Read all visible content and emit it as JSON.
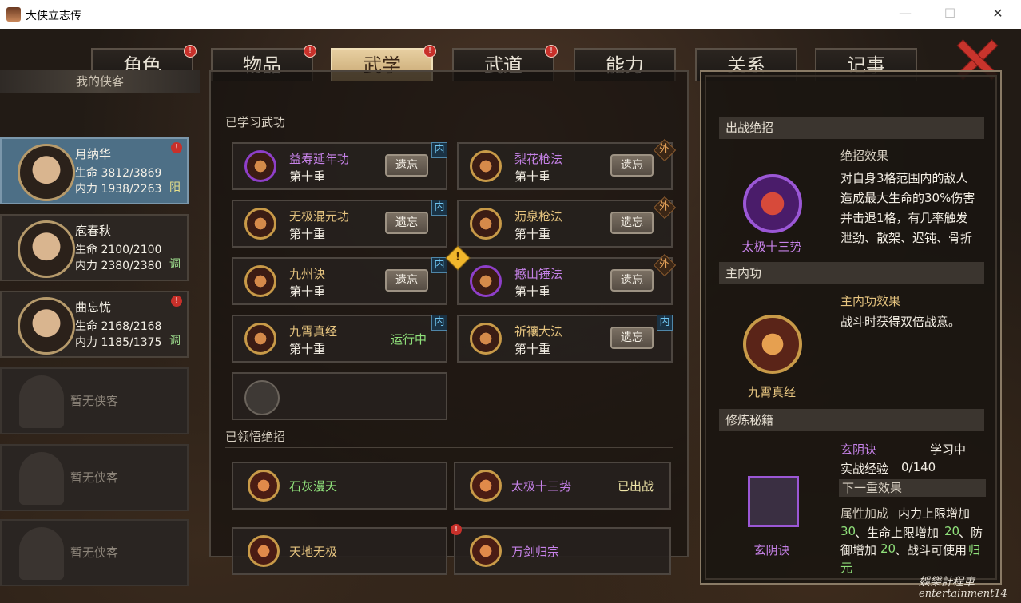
{
  "window": {
    "title": "大侠立志传",
    "min_label": "—",
    "max_label": "☐",
    "close_label": "✕"
  },
  "tabs": [
    {
      "label": "角色",
      "alert": "!"
    },
    {
      "label": "物品",
      "alert": "!"
    },
    {
      "label": "武学",
      "alert": "!",
      "active": true
    },
    {
      "label": "武道",
      "alert": "!"
    },
    {
      "label": "能力",
      "alert": ""
    },
    {
      "label": "关系",
      "alert": ""
    },
    {
      "label": "记事",
      "alert": ""
    }
  ],
  "roster": {
    "header": "我的侠客",
    "heroes": [
      {
        "name": "月纳华",
        "hp": "生命 3812/3869",
        "mp": "内力 1938/2263",
        "tag": "阳",
        "alert": "!"
      },
      {
        "name": "庖春秋",
        "hp": "生命 2100/2100",
        "mp": "内力 2380/2380",
        "tag": "调",
        "alert": ""
      },
      {
        "name": "曲忘忧",
        "hp": "生命 2168/2168",
        "mp": "内力 1185/1375",
        "tag": "调",
        "alert": "!"
      }
    ],
    "empty_label": "暂无侠客"
  },
  "learned": {
    "title": "已学习武功",
    "forget_label": "遗忘",
    "running_label": "运行中",
    "level_label": "第十重",
    "skills": [
      {
        "name": "益寿延年功",
        "color": "#c682e8",
        "type": "内",
        "ring": "#8e3fc9"
      },
      {
        "name": "梨花枪法",
        "color": "#c682e8",
        "type": "外",
        "ring": "#c89a48"
      },
      {
        "name": "无极混元功",
        "color": "#e6c47f",
        "type": "内",
        "ring": "#c89a48"
      },
      {
        "name": "沥泉枪法",
        "color": "#e6c47f",
        "type": "外",
        "ring": "#c89a48"
      },
      {
        "name": "九州诀",
        "color": "#e6c47f",
        "type": "内",
        "ring": "#c89a48"
      },
      {
        "name": "撼山锤法",
        "color": "#c682e8",
        "type": "外",
        "ring": "#8e3fc9",
        "warn": "!"
      },
      {
        "name": "九霄真经",
        "color": "#e6c47f",
        "type": "内",
        "ring": "#c89a48",
        "running": true
      },
      {
        "name": "祈禳大法",
        "color": "#e6c47f",
        "type": "内",
        "ring": "#c89a48"
      }
    ]
  },
  "ultimates": {
    "title": "已领悟绝招",
    "items": [
      {
        "name": "石灰漫天",
        "color": "#8fe07a",
        "status": ""
      },
      {
        "name": "太极十三势",
        "color": "#c682e8",
        "status": "已出战"
      },
      {
        "name": "天地无极",
        "color": "#e6c47f",
        "status": ""
      },
      {
        "name": "万剑归宗",
        "color": "#c682e8",
        "status": "",
        "alert": "!"
      }
    ]
  },
  "detail": {
    "battle_header": "出战绝招",
    "battle_skill": "太极十三势",
    "effect_title": "绝招效果",
    "effect_lines": [
      "对自身3格范围内的敌人",
      "造成最大生命的30%伤害",
      "并击退1格，有几率触发",
      "泄劲、散架、迟钝、骨折"
    ],
    "main_header": "主内功",
    "main_skill": "九霄真经",
    "main_effect_title": "主内功效果",
    "main_effect": "战斗时获得双倍战意。",
    "train_header": "修炼秘籍",
    "book_name": "玄阴诀",
    "book_status": "学习中",
    "exp_label": "实战经验",
    "exp_value": "0/140",
    "next_label": "下一重效果",
    "attr_label": "属性加成",
    "attr_text_1": "内力上限增加",
    "attr_v1": "30",
    "attr_text_2": "、生命上限增加",
    "attr_v2": "20",
    "attr_text_3": "、防",
    "attr_text_4": "御增加",
    "attr_v3": "20",
    "attr_text_5": "、战斗可使用",
    "attr_v4": "归",
    "attr_v5": "元"
  },
  "watermark": {
    "line1": "娛樂計程車",
    "line2": "entertainment14"
  }
}
